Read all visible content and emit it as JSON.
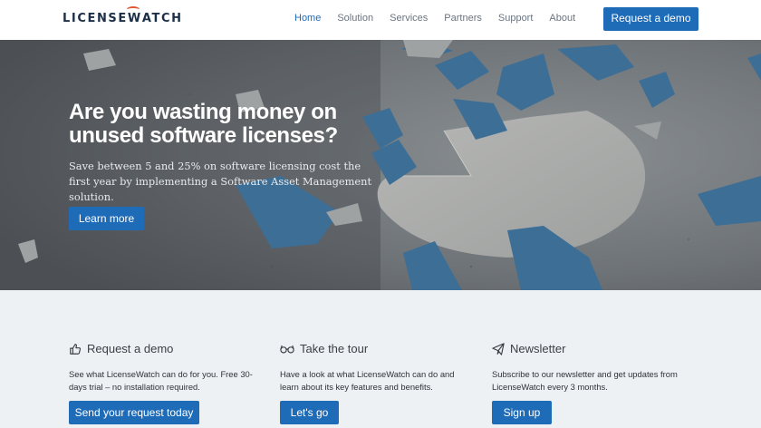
{
  "brand": {
    "logo_text_pre": "LICENSE",
    "logo_text_w": "W",
    "logo_text_post": "ATCH"
  },
  "nav": {
    "items": [
      {
        "label": "Home",
        "active": true
      },
      {
        "label": "Solution",
        "active": false
      },
      {
        "label": "Services",
        "active": false
      },
      {
        "label": "Partners",
        "active": false
      },
      {
        "label": "Support",
        "active": false
      },
      {
        "label": "About",
        "active": false
      }
    ],
    "cta_label": "Request a demo"
  },
  "hero": {
    "title": "Are you wasting money on unused software licenses?",
    "subtitle": "Save between 5 and 25% on software licensing cost the first year by implementing a Software Asset Management solution.",
    "button_label": "Learn more"
  },
  "features": [
    {
      "icon": "thumbs-up-icon",
      "title": "Request a demo",
      "text": "See what LicenseWatch can do for you. Free 30-days trial – no installation required.",
      "button_label": "Send your request today"
    },
    {
      "icon": "glasses-icon",
      "title": "Take the tour",
      "text": "Have a look at what LicenseWatch can do and learn about its key features and benefits.",
      "button_label": "Let's go"
    },
    {
      "icon": "paper-plane-icon",
      "title": "Newsletter",
      "text": "Subscribe to our newsletter and get updates from LicenseWatch every 3 months.",
      "button_label": "Sign up"
    }
  ],
  "colors": {
    "accent": "#1e6bb8",
    "logo_dark": "#1d2f46",
    "logo_mark": "#e0532b",
    "feature_bg": "#eef1f4"
  }
}
